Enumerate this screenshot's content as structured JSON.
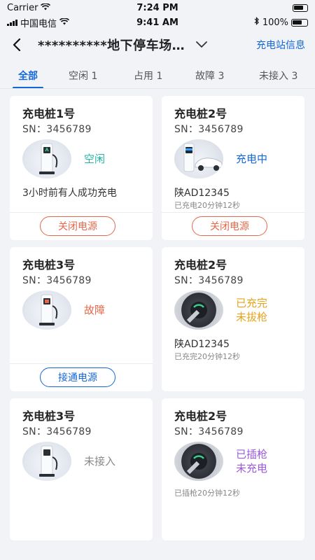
{
  "status_bar": {
    "carrier_top": "Carrier",
    "time_top": "7:24 PM",
    "carrier": "中国电信",
    "time": "9:41 AM",
    "battery": "100%"
  },
  "nav": {
    "title": "**********地下停车场…",
    "right_link": "充电站信息"
  },
  "tabs": [
    {
      "label": "全部"
    },
    {
      "label": "空闲 1"
    },
    {
      "label": "占用 1"
    },
    {
      "label": "故障 3"
    },
    {
      "label": "未接入 3"
    }
  ],
  "colors": {
    "accent": "#1467d8",
    "idle": "#1fb5a3",
    "charging": "#1467d8",
    "fault": "#e5684a",
    "done": "#e8a318",
    "offline": "#888888",
    "plugged": "#9b59e0"
  },
  "cards": [
    {
      "title": "充电桩1号",
      "sn": "SN：3456789",
      "status": [
        "空闲"
      ],
      "line1": "3小时前有人成功充电",
      "line2": "",
      "button": "关闭电源"
    },
    {
      "title": "充电桩2号",
      "sn": "SN：3456789",
      "status": [
        "充电中"
      ],
      "line1": "陕AD12345",
      "line2": "已充电20分钟12秒",
      "button": "关闭电源"
    },
    {
      "title": "充电桩3号",
      "sn": "SN：3456789",
      "status": [
        "故障"
      ],
      "line1": "",
      "line2": "",
      "button": "接通电源"
    },
    {
      "title": "充电桩2号",
      "sn": "SN：3456789",
      "status": [
        "已充完",
        "未拔枪"
      ],
      "line1": "陕AD12345",
      "line2": "已充完20分钟12秒",
      "button": ""
    },
    {
      "title": "充电桩3号",
      "sn": "SN：3456789",
      "status": [
        "未接入"
      ],
      "line1": "",
      "line2": "",
      "button": ""
    },
    {
      "title": "充电桩2号",
      "sn": "SN：3456789",
      "status": [
        "已插枪",
        "未充电"
      ],
      "line1": "",
      "line2": "已插枪20分钟12秒",
      "button": ""
    }
  ]
}
